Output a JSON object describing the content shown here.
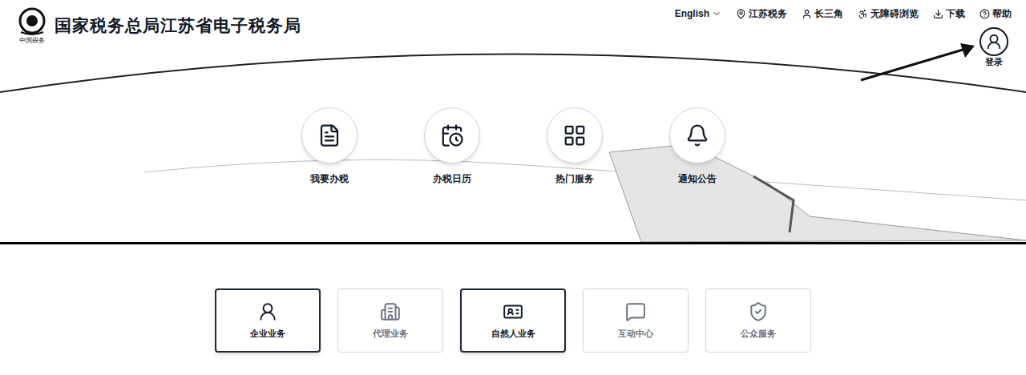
{
  "header": {
    "title": "国家税务总局江苏省电子税务局",
    "logo_caption": "中国税务"
  },
  "top_nav": [
    {
      "label": "English",
      "kind": "dropdown"
    },
    {
      "label": "江苏税务",
      "kind": "link"
    },
    {
      "label": "长三角",
      "kind": "link"
    },
    {
      "label": "无障碍浏览",
      "kind": "link"
    },
    {
      "label": "下载",
      "kind": "link"
    },
    {
      "label": "帮助",
      "kind": "link"
    }
  ],
  "login": {
    "label": "登录"
  },
  "quick_links": [
    {
      "label": "我要办税"
    },
    {
      "label": "办税日历"
    },
    {
      "label": "热门服务"
    },
    {
      "label": "通知公告"
    }
  ],
  "entry_cards": [
    {
      "label": "企业业务",
      "highlighted": true
    },
    {
      "label": "代理业务",
      "highlighted": false
    },
    {
      "label": "自然人业务",
      "highlighted": true
    },
    {
      "label": "互动中心",
      "highlighted": false
    },
    {
      "label": "公众服务",
      "highlighted": false
    }
  ]
}
